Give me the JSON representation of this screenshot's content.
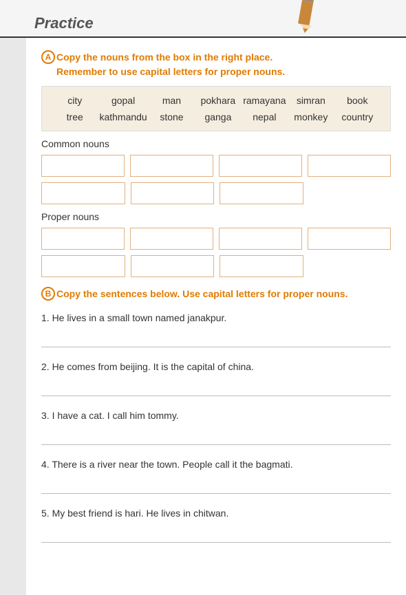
{
  "header": {
    "title": "Practice"
  },
  "sectionA": {
    "label": "A",
    "instruction_line1": "Copy the nouns from the box in the right place.",
    "instruction_line2": "Remember to use capital letters for proper nouns.",
    "word_box": [
      "city",
      "gopal",
      "man",
      "pokhara",
      "ramayana",
      "simran",
      "book",
      "tree",
      "kathmandu",
      "stone",
      "ganga",
      "nepal",
      "monkey",
      "country"
    ],
    "common_nouns_label": "Common nouns",
    "proper_nouns_label": "Proper nouns"
  },
  "sectionB": {
    "label": "B",
    "instruction": "Copy the sentences below. Use capital letters for proper nouns.",
    "sentences": [
      "1. He lives in a small town named janakpur.",
      "2. He comes from beijing. It is the capital of china.",
      "3. I have a cat. I call him tommy.",
      "4. There is a river near the town. People call it the bagmati.",
      "5. My best friend is hari. He lives in chitwan."
    ]
  }
}
